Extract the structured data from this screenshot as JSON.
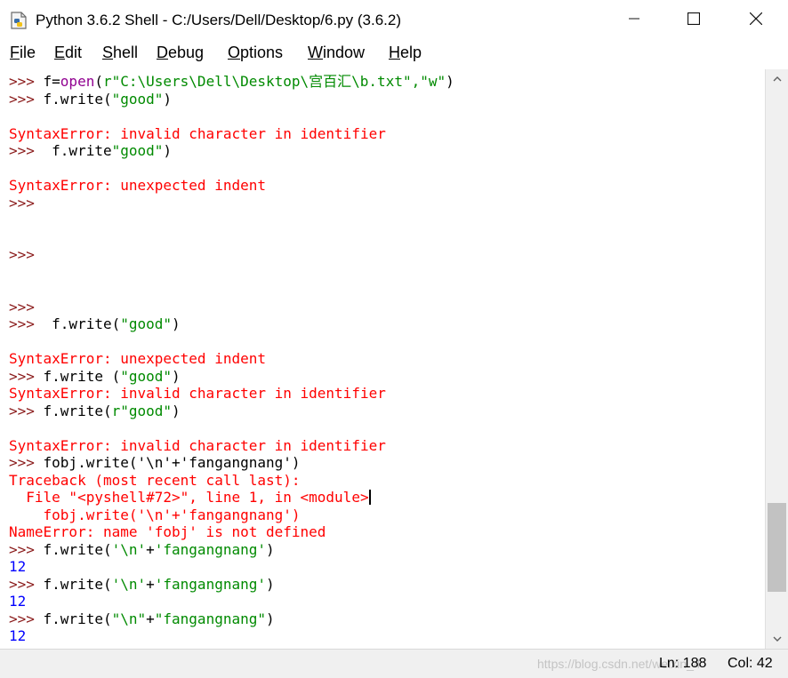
{
  "window": {
    "title": "Python 3.6.2 Shell - C:/Users/Dell/Desktop/6.py (3.6.2)",
    "icon": "python-idle-icon",
    "minimize_icon": "minimize-icon",
    "maximize_icon": "maximize-icon",
    "close_icon": "close-icon"
  },
  "menu": {
    "file": "File",
    "edit": "Edit",
    "shell": "Shell",
    "debug": "Debug",
    "options": "Options",
    "window": "Window",
    "help": "Help"
  },
  "shell": {
    "l1": {
      "prompt": ">>> ",
      "a": "f=",
      "b": "open",
      "c": "(",
      "d": "r\"C:\\Users\\Dell\\Desktop\\宫百汇\\b.txt\",\"w\"",
      "e": ")"
    },
    "l2": {
      "prompt": ">>> ",
      "a": "f.write(",
      "b": "\"good\"",
      "c": ")"
    },
    "l3": {
      "text": "SyntaxError: invalid character in identifier"
    },
    "l4": {
      "prompt": ">>> ",
      "a": " f.write",
      "b": "\"good\"",
      "c": ")"
    },
    "l5": {
      "text": "SyntaxError: unexpected indent"
    },
    "l6": {
      "prompt": ">>>"
    },
    "l7": {
      "prompt": ">>>"
    },
    "l8": {
      "prompt": ">>>"
    },
    "l9": {
      "prompt": ">>> ",
      "a": " f.write(",
      "b": "\"good\"",
      "c": ")"
    },
    "l10": {
      "text": "SyntaxError: unexpected indent"
    },
    "l11": {
      "prompt": ">>> ",
      "a": "f.write (",
      "b": "\"good\"",
      "c": ")"
    },
    "l12": {
      "text": "SyntaxError: invalid character in identifier"
    },
    "l13": {
      "prompt": ">>> ",
      "a": "f.write(",
      "b": "r\"good\"",
      "c": ")"
    },
    "l14": {
      "text": "SyntaxError: invalid character in identifier"
    },
    "l15": {
      "prompt": ">>> ",
      "a": "fobj.write('\\n'+'fangangnang')"
    },
    "l16": {
      "text": "Traceback (most recent call last):"
    },
    "l17": {
      "text": "  File \"<pyshell#72>\", line 1, in <module>"
    },
    "l18": {
      "text": "    fobj.write('\\n'+'fangangnang')"
    },
    "l19": {
      "text": "NameError: name 'fobj' is not defined"
    },
    "l20": {
      "prompt": ">>> ",
      "a": "f.write(",
      "b": "'\\n'",
      "c": "+",
      "d": "'fangangnang'",
      "e": ")"
    },
    "l21": {
      "text": "12"
    },
    "l22": {
      "prompt": ">>> ",
      "a": "f.write(",
      "b": "'\\n'",
      "c": "+",
      "d": "'fangangnang'",
      "e": ")"
    },
    "l23": {
      "text": "12"
    },
    "l24": {
      "prompt": ">>> ",
      "a": "f.write(",
      "b": "\"\\n\"",
      "c": "+",
      "d": "\"fangangnang\"",
      "e": ")"
    },
    "l25": {
      "text": "12"
    }
  },
  "status": {
    "line": "Ln: 188",
    "col": "Col: 42",
    "watermark": "https://blog.csdn.net/weixin_4"
  }
}
